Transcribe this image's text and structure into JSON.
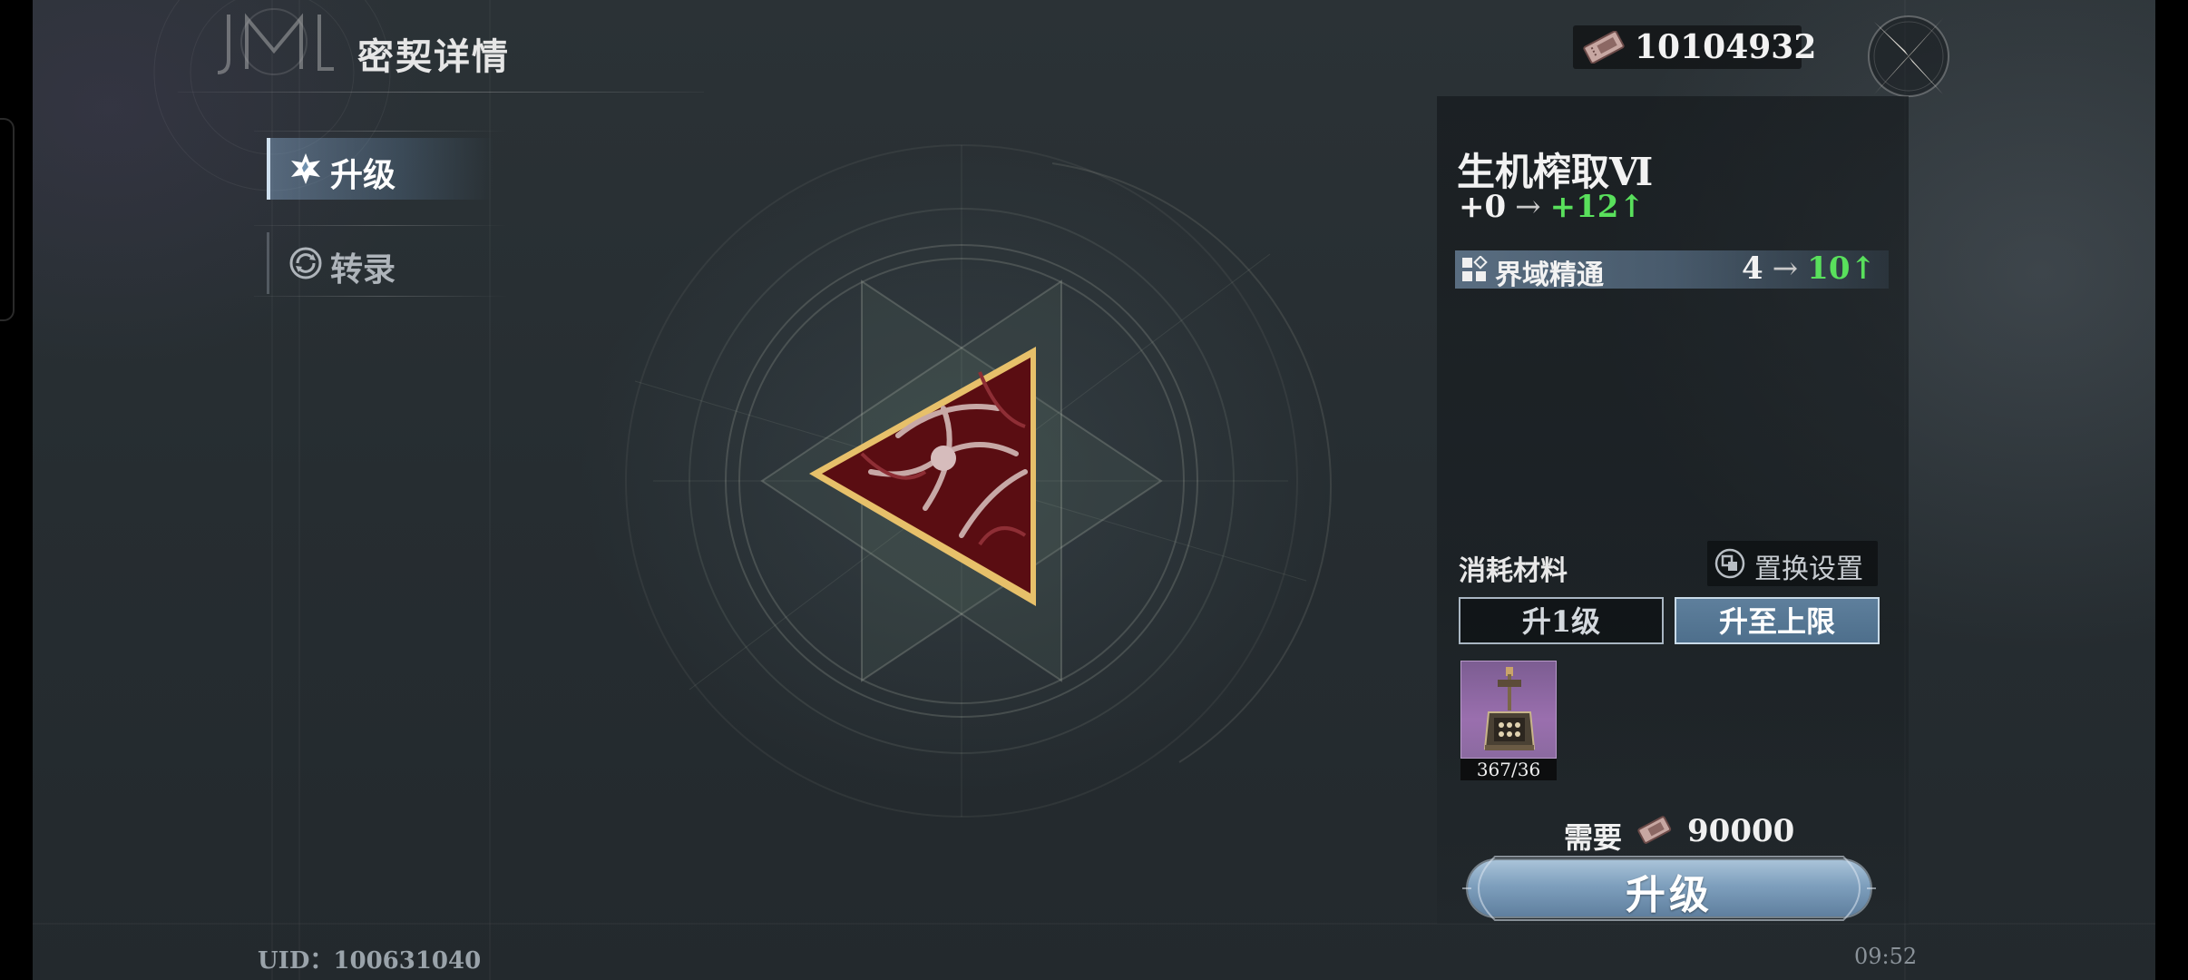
{
  "header": {
    "title": "密契详情",
    "currency_value": "10104932"
  },
  "tabs": [
    {
      "label": "升级",
      "active": true
    },
    {
      "label": "转录",
      "active": false
    }
  ],
  "footer": {
    "uid": "UID：100631040",
    "time": "09:52"
  },
  "detail": {
    "name": "生机榨取Ⅵ",
    "bonus_from": "+0",
    "bonus_to": "+12",
    "arrow": "→",
    "up_mark": "↑",
    "attribute": {
      "label": "界域精通",
      "from": "4",
      "to": "10"
    },
    "materials_label": "消耗材料",
    "replace_button_label": "置换设置",
    "level_one_label": "升1级",
    "level_max_label": "升至上限",
    "material": {
      "count": "367/36"
    },
    "need_label": "需要",
    "need_value": "90000",
    "upgrade_label": "升级"
  },
  "colors": {
    "accent_green": "#59e05c",
    "tab_active": "#6f90ae",
    "emblem_gold": "#e7c06a",
    "emblem_red": "#5a0d12"
  },
  "icons": {
    "currency": "ticket-icon",
    "close": "compass-star-close-icon",
    "tab_upgrade": "star-badge-icon",
    "tab_transcribe": "circular-arrows-icon",
    "attribute": "grid-squares-icon",
    "replace": "swap-icon",
    "material": "lantern-relic-icon"
  }
}
